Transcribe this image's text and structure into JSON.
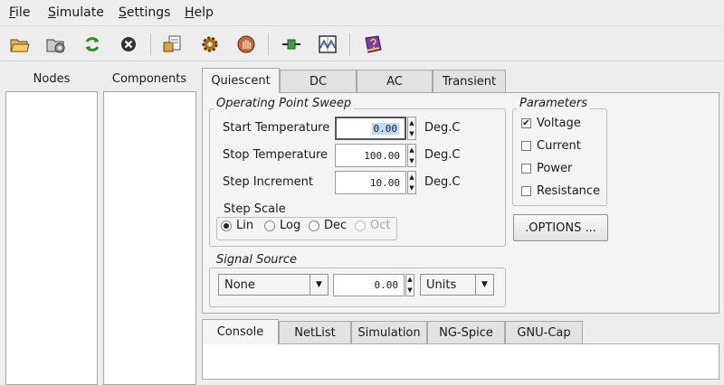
{
  "menu": [
    {
      "label": "File",
      "key": "F",
      "rest": "ile"
    },
    {
      "label": "Simulate",
      "key": "S",
      "rest": "imulate"
    },
    {
      "label": "Settings",
      "key": "S",
      "rest": "ettings"
    },
    {
      "label": "Help",
      "key": "H",
      "rest": "elp"
    }
  ],
  "toolbar": {
    "icons": [
      "open-folder-icon",
      "open-settings-icon",
      "refresh-icon",
      "stop-icon",
      "netlist-icon",
      "gear-icon",
      "hand-icon",
      "connector-icon",
      "waveform-icon",
      "help-book-icon"
    ]
  },
  "left": {
    "nodes_title": "Nodes",
    "components_title": "Components"
  },
  "tabs_top": [
    "Quiescent",
    "DC",
    "AC",
    "Transient"
  ],
  "sweep": {
    "title": "Operating Point Sweep",
    "start_label": "Start Temperature",
    "start_value": "0.00",
    "stop_label": "Stop Temperature",
    "stop_value": "100.00",
    "step_label": "Step Increment",
    "step_value": "10.00",
    "unit": "Deg.C",
    "scale_title": "Step Scale",
    "scale_options": [
      "Lin",
      "Log",
      "Dec",
      "Oct"
    ]
  },
  "parameters": {
    "title": "Parameters",
    "items": [
      {
        "label": "Voltage",
        "checked": true
      },
      {
        "label": "Current",
        "checked": false
      },
      {
        "label": "Power",
        "checked": false
      },
      {
        "label": "Resistance",
        "checked": false
      }
    ],
    "options_button": ".OPTIONS ..."
  },
  "signal": {
    "title": "Signal Source",
    "source": "None",
    "value": "0.00",
    "units": "Units"
  },
  "tabs_bottom": [
    "Console",
    "NetList",
    "Simulation",
    "NG-Spice",
    "GNU-Cap"
  ],
  "colors": {
    "selection": "#c4d8f4",
    "panel": "#f4f4f4",
    "background": "#ededed"
  }
}
